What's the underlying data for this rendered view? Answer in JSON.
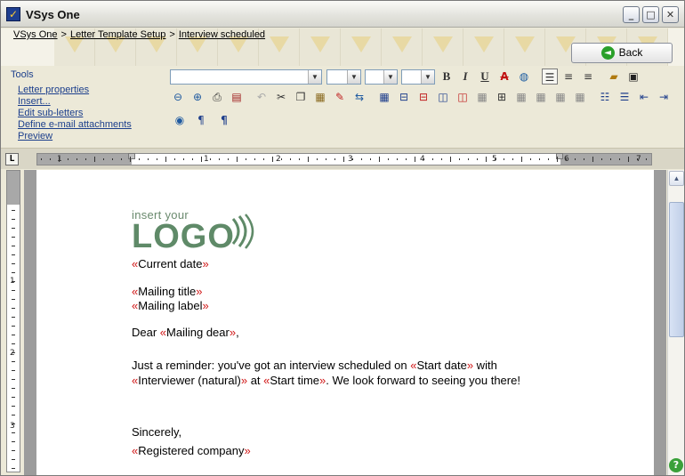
{
  "window": {
    "title": "VSys One"
  },
  "breadcrumb": [
    {
      "label": "VSys One"
    },
    {
      "label": "Letter Template Setup"
    },
    {
      "label": "Interview scheduled"
    }
  ],
  "breadcrumb_sep": ">",
  "back_button": {
    "label": "Back"
  },
  "tools": {
    "title": "Tools",
    "items": [
      "Letter properties",
      "Insert...",
      "Edit sub-letters",
      "Define e-mail attachments",
      "Preview"
    ]
  },
  "toolbar": {
    "bold": "B",
    "italic": "I",
    "underline": "U",
    "strike": "A"
  },
  "ruler": {
    "corner": "L",
    "numbers": [
      "1",
      "1",
      "2",
      "3",
      "4",
      "5",
      "6",
      "7"
    ],
    "vnumbers": [
      "1",
      "2",
      "3"
    ]
  },
  "letter": {
    "logo_small": "insert your",
    "logo_big": "LOGO",
    "current_date": "Current date",
    "mailing_title": "Mailing title",
    "mailing_label": "Mailing label",
    "dear_prefix": "Dear ",
    "mailing_dear": "Mailing dear",
    "dear_suffix": ",",
    "reminder_prefix": "Just a reminder: you've got an interview scheduled on ",
    "start_date": "Start date",
    "reminder_suffix": " with",
    "interviewer": "Interviewer (natural)",
    "at_text": " at ",
    "start_time": "Start time",
    "closing_text": ". We look forward to seeing you there!",
    "sincerely": "Sincerely,",
    "registered_company": "Registered company"
  },
  "colors": {
    "field_marker": "#d01414",
    "link": "#1c3f8c",
    "logo": "#5f8a68"
  }
}
